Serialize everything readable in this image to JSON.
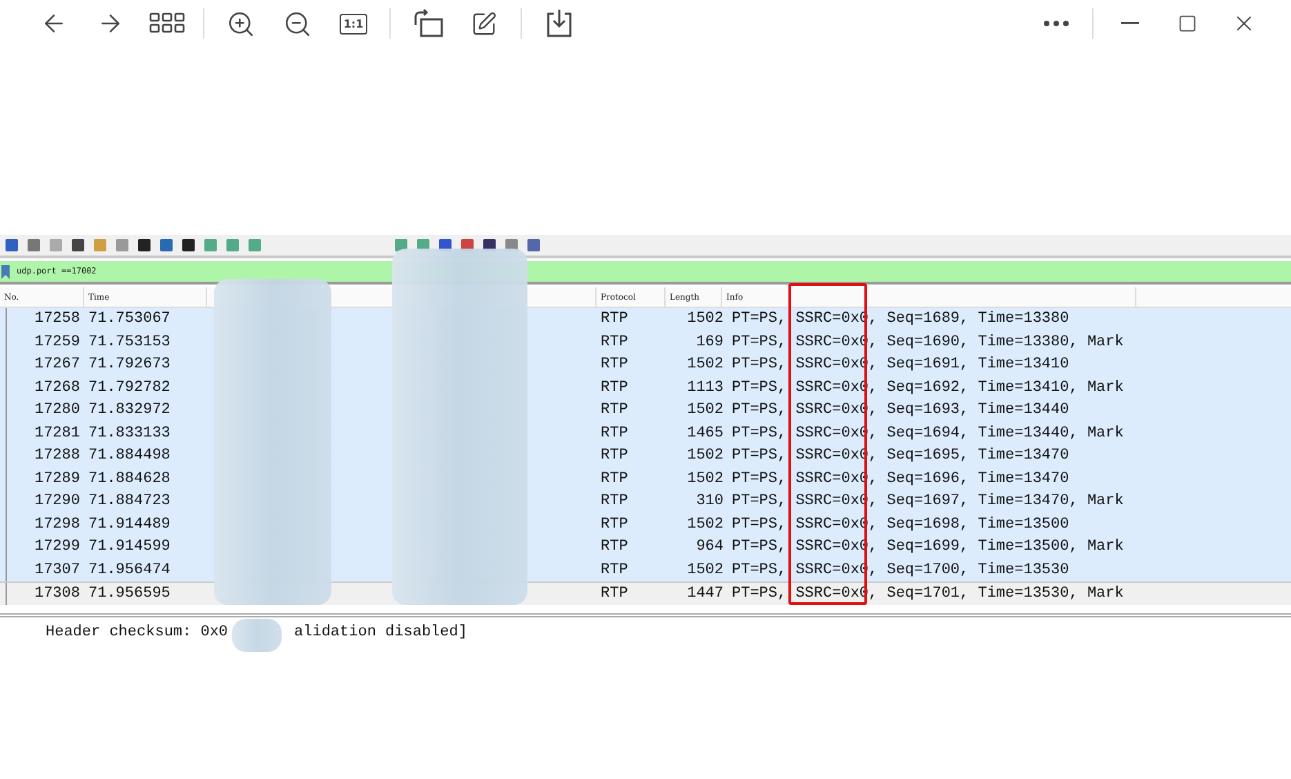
{
  "viewer_toolbar": {
    "actual_size_label": "1:1"
  },
  "capture": {
    "filter": "udp.port ==17002",
    "columns": [
      "No.",
      "Time",
      "Protocol",
      "Length",
      "Info"
    ],
    "packets": [
      {
        "no": "17258",
        "time": "71.753067",
        "protocol": "RTP",
        "length": "1502",
        "info": "PT=PS, SSRC=0x0, Seq=1689, Time=13380",
        "selected": false
      },
      {
        "no": "17259",
        "time": "71.753153",
        "protocol": "RTP",
        "length": "169",
        "info": "PT=PS, SSRC=0x0, Seq=1690, Time=13380, Mark",
        "selected": false
      },
      {
        "no": "17267",
        "time": "71.792673",
        "protocol": "RTP",
        "length": "1502",
        "info": "PT=PS, SSRC=0x0, Seq=1691, Time=13410",
        "selected": false
      },
      {
        "no": "17268",
        "time": "71.792782",
        "protocol": "RTP",
        "length": "1113",
        "info": "PT=PS, SSRC=0x0, Seq=1692, Time=13410, Mark",
        "selected": false
      },
      {
        "no": "17280",
        "time": "71.832972",
        "protocol": "RTP",
        "length": "1502",
        "info": "PT=PS, SSRC=0x0, Seq=1693, Time=13440",
        "selected": false
      },
      {
        "no": "17281",
        "time": "71.833133",
        "protocol": "RTP",
        "length": "1465",
        "info": "PT=PS, SSRC=0x0, Seq=1694, Time=13440, Mark",
        "selected": false
      },
      {
        "no": "17288",
        "time": "71.884498",
        "protocol": "RTP",
        "length": "1502",
        "info": "PT=PS, SSRC=0x0, Seq=1695, Time=13470",
        "selected": false
      },
      {
        "no": "17289",
        "time": "71.884628",
        "protocol": "RTP",
        "length": "1502",
        "info": "PT=PS, SSRC=0x0, Seq=1696, Time=13470",
        "selected": false
      },
      {
        "no": "17290",
        "time": "71.884723",
        "protocol": "RTP",
        "length": "310",
        "info": "PT=PS, SSRC=0x0, Seq=1697, Time=13470, Mark",
        "selected": false
      },
      {
        "no": "17298",
        "time": "71.914489",
        "protocol": "RTP",
        "length": "1502",
        "info": "PT=PS, SSRC=0x0, Seq=1698, Time=13500",
        "selected": false
      },
      {
        "no": "17299",
        "time": "71.914599",
        "protocol": "RTP",
        "length": "964",
        "info": "PT=PS, SSRC=0x0, Seq=1699, Time=13500, Mark",
        "selected": false
      },
      {
        "no": "17307",
        "time": "71.956474",
        "protocol": "RTP",
        "length": "1502",
        "info": "PT=PS, SSRC=0x0, Seq=1700, Time=13530",
        "selected": false
      },
      {
        "no": "17308",
        "time": "71.956595",
        "protocol": "RTP",
        "length": "1447",
        "info": "PT=PS, SSRC=0x0, Seq=1701, Time=13530, Mark",
        "selected": true
      }
    ],
    "detail": [
      "Header checksum: 0x0",
      "alidation disabled]"
    ]
  }
}
